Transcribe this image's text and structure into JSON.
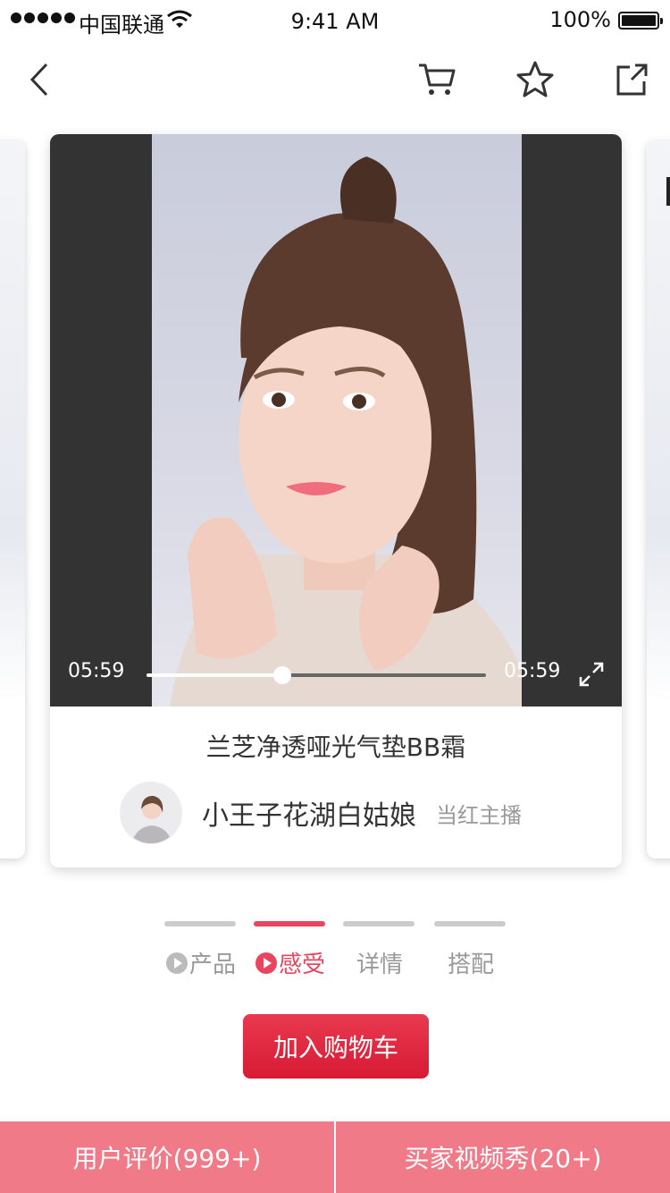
{
  "status_bar": {
    "carrier": "中国联通",
    "time": "9:41 AM",
    "battery": "100%"
  },
  "nav": {
    "back_icon": "chevron-left-icon",
    "cart_icon": "cart-icon",
    "favorite_icon": "star-icon",
    "share_icon": "share-icon"
  },
  "video": {
    "current_time": "05:59",
    "total_time": "05:59",
    "progress": 0.4
  },
  "product": {
    "title": "兰芝净透哑光气垫BB霜",
    "author_name": "小王子花湖白姑娘",
    "author_role": "当红主播"
  },
  "tabs": [
    {
      "label": "产品",
      "has_play": true,
      "active": false
    },
    {
      "label": "感受",
      "has_play": true,
      "active": true
    },
    {
      "label": "详情",
      "has_play": false,
      "active": false
    },
    {
      "label": "搭配",
      "has_play": false,
      "active": false
    }
  ],
  "actions": {
    "add_to_cart": "加入购物车",
    "reviews": "用户评价(999+)",
    "buyer_videos": "买家视频秀(20+)"
  },
  "colors": {
    "accent": "#e8455f",
    "button": "#d81a35",
    "bottom_bar": "#f07a87"
  }
}
